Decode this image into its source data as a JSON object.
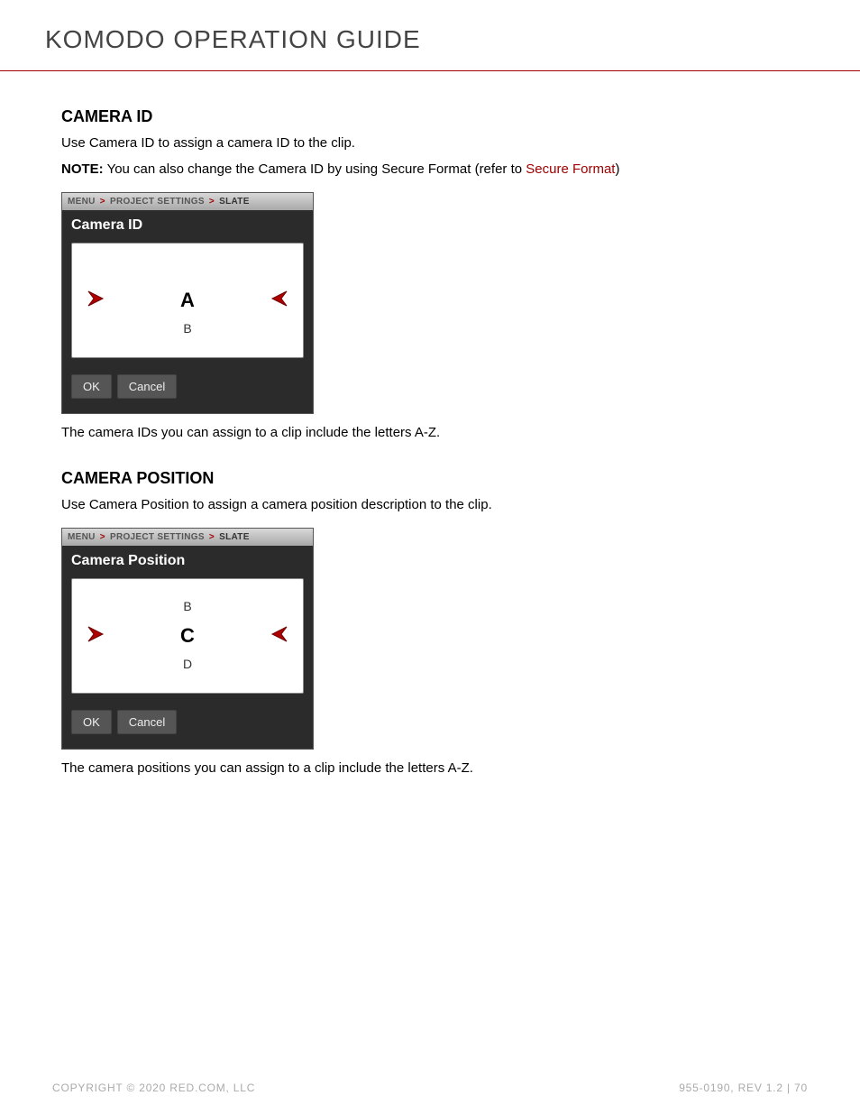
{
  "header": {
    "title": "KOMODO OPERATION GUIDE"
  },
  "sections": {
    "camera_id": {
      "heading": "CAMERA ID",
      "intro": "Use Camera ID to assign a camera ID to the clip.",
      "note_label": "NOTE:",
      "note_text_before": " You can also change the Camera ID by using Secure Format (refer to ",
      "note_link": "Secure Format",
      "note_text_after": ")",
      "caption": "The camera IDs you can assign to a clip include the letters A-Z."
    },
    "camera_position": {
      "heading": "CAMERA POSITION",
      "intro": "Use Camera Position to assign a camera position description to the clip.",
      "caption": "The camera positions you can assign to a clip include the letters A-Z."
    }
  },
  "panel1": {
    "breadcrumb": {
      "a": "MENU",
      "b": "PROJECT SETTINGS",
      "c": "SLATE"
    },
    "title": "Camera ID",
    "above": "",
    "selected": "A",
    "below": "B",
    "ok": "OK",
    "cancel": "Cancel"
  },
  "panel2": {
    "breadcrumb": {
      "a": "MENU",
      "b": "PROJECT SETTINGS",
      "c": "SLATE"
    },
    "title": "Camera Position",
    "above": "B",
    "selected": "C",
    "below": "D",
    "ok": "OK",
    "cancel": "Cancel"
  },
  "footer": {
    "left": "COPYRIGHT © 2020 RED.COM, LLC",
    "right": "955-0190, REV 1.2  |  70"
  }
}
